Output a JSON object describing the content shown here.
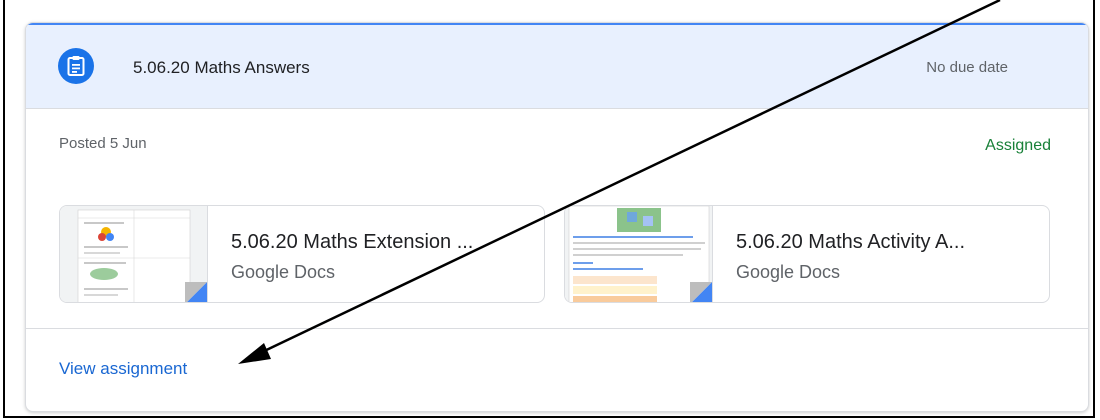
{
  "assignment": {
    "title": "5.06.20 Maths Answers",
    "due_date": "No due date",
    "posted": "Posted 5 Jun",
    "status": "Assigned",
    "status_color": "#188038",
    "icon": "assignment-icon"
  },
  "attachments": [
    {
      "title": "5.06.20 Maths Extension ...",
      "type": "Google Docs",
      "icon": "google-docs-thumbnail"
    },
    {
      "title": "5.06.20 Maths Activity A...",
      "type": "Google Docs",
      "icon": "google-docs-thumbnail"
    }
  ],
  "footer": {
    "view_link": "View assignment"
  },
  "colors": {
    "accent": "#1a73e8",
    "header_bg": "#e8f0fe",
    "link": "#1967d2"
  }
}
